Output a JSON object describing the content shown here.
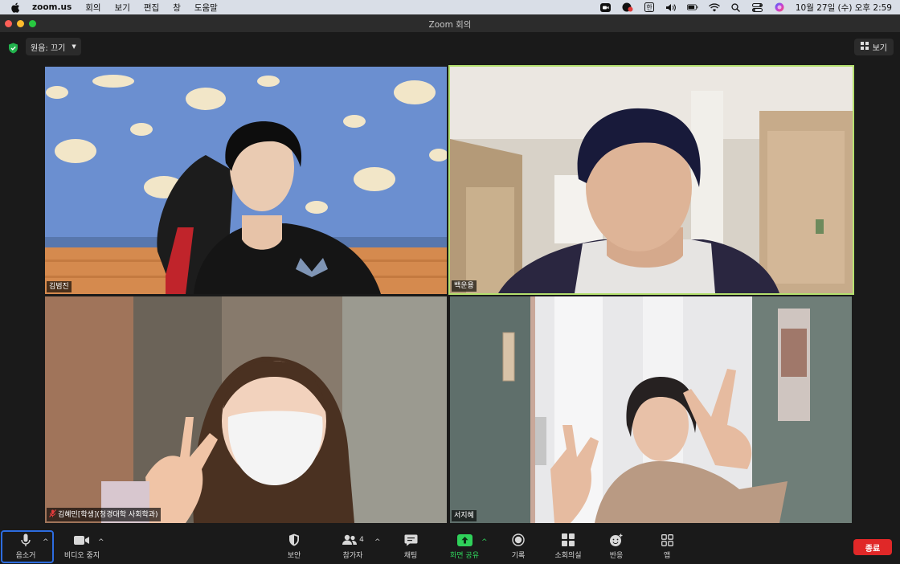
{
  "menubar": {
    "app_name": "zoom.us",
    "menus": [
      "회의",
      "보기",
      "편집",
      "창",
      "도움말"
    ],
    "datetime": "10월 27일 (수) 오후 2:59"
  },
  "window": {
    "title": "Zoom 회의"
  },
  "top": {
    "original_sound_label": "원음: 끄기",
    "view_label": "보기"
  },
  "participants": [
    {
      "name": "김범진",
      "muted": false
    },
    {
      "name": "백운용",
      "muted": false,
      "active_speaker": true
    },
    {
      "name": "김혜민[학생](청경대학 사회학과)",
      "muted": true
    },
    {
      "name": "서지혜",
      "muted": false
    }
  ],
  "toolbar": {
    "mute_label": "음소거",
    "video_label": "비디오 중지",
    "security_label": "보안",
    "participants_label": "참가자",
    "participants_count": "4",
    "chat_label": "채팅",
    "share_label": "화면 공유",
    "record_label": "기록",
    "breakout_label": "소회의실",
    "reactions_label": "반응",
    "apps_label": "앱",
    "end_label": "종료"
  },
  "colors": {
    "accent_green": "#2fd15a",
    "end_red": "#e02828",
    "active_border": "#b4e06e",
    "focus_blue": "#2d6cdf"
  }
}
